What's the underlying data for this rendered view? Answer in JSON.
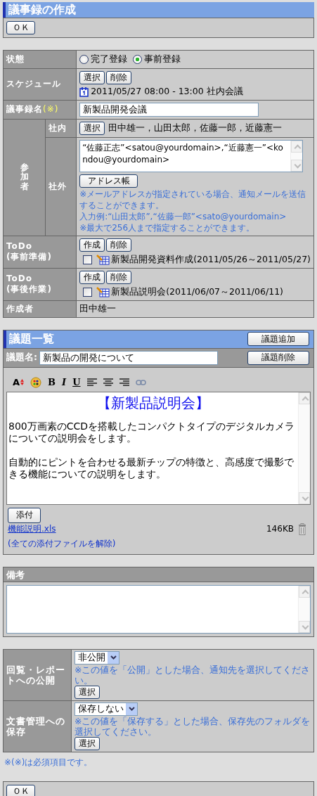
{
  "title": "議事録の作成",
  "top_button": "ＯＫ",
  "form": {
    "status": {
      "label": "状態",
      "options": [
        {
          "label": "完了登録",
          "selected": false
        },
        {
          "label": "事前登録",
          "selected": true
        }
      ]
    },
    "schedule": {
      "label": "スケジュール",
      "buttons": [
        "選択",
        "削除"
      ],
      "entry": "2011/05/27 08:00 - 13:00 社内会議"
    },
    "minutes_name": {
      "label": "議事録名",
      "required_mark": "(※)",
      "value": "新製品開発会議"
    },
    "participants": {
      "label": "参加者",
      "internal": {
        "label": "社内",
        "button": "選択",
        "names": "田中雄一，山田太郎，佐藤一郎，近藤憲一"
      },
      "external": {
        "label": "社外",
        "value": "“佐藤正志”<satou@yourdomain>,“近藤憲一”<kondou@yourdomain>",
        "button": "アドレス帳",
        "notes": [
          "※メールアドレスが指定されている場合、通知メールを送信することができます。",
          "入力例:“山田太郎”,“佐藤一郎”<sato@yourdomain>",
          "※最大で256人まで指定することができます。"
        ]
      }
    },
    "todos": [
      {
        "label": "ToDo",
        "sublabel": "(事前準備)",
        "buttons": [
          "作成",
          "削除"
        ],
        "items": [
          {
            "text": "新製品開発資料作成(2011/05/26～2011/05/27)",
            "checked": false
          }
        ]
      },
      {
        "label": "ToDo",
        "sublabel": "(事後作業)",
        "buttons": [
          "作成",
          "削除"
        ],
        "items": [
          {
            "text": "新製品説明会(2011/06/07～2011/06/11)",
            "checked": false
          }
        ]
      }
    ],
    "author": {
      "label": "作成者",
      "value": "田中雄一"
    }
  },
  "agenda": {
    "title": "議題一覧",
    "add_button": "議題追加",
    "name_label": "議題名:",
    "name_value": "新製品の開発について",
    "delete_button": "議題削除",
    "toolbar": [
      {
        "kind": "font-size",
        "glyph": "A"
      },
      {
        "kind": "color"
      },
      {
        "kind": "bold",
        "glyph": "B"
      },
      {
        "kind": "italic",
        "glyph": "I"
      },
      {
        "kind": "underline",
        "glyph": "U"
      },
      {
        "kind": "align-left"
      },
      {
        "kind": "align-center"
      },
      {
        "kind": "align-right"
      },
      {
        "kind": "link"
      }
    ],
    "editor": {
      "heading": "【新製品説明会】",
      "paragraphs": [
        "800万画素のCCDを搭載したコンパクトタイプのデジタルカメラについての説明会をします。",
        "自動的にピントを合わせる最新チップの特徴と、高感度で撮影できる機能についての説明をします。"
      ]
    },
    "attach_button": "添付",
    "attachments": [
      {
        "name": "機能説明.xls",
        "size": "146KB"
      }
    ],
    "remove_all": "(全ての添付ファイルを解除)"
  },
  "remarks": {
    "label": "備考"
  },
  "publish": [
    {
      "label": "回覧・レポートへの公開",
      "select": "非公開",
      "note": "※この値を「公開」とした場合、通知先を選択してください。",
      "button": "選択"
    },
    {
      "label": "文書管理への保存",
      "select": "保存しない",
      "note": "※この値を「保存する」とした場合、保存先のフォルダを選択してください。",
      "button": "選択"
    }
  ],
  "footnote": "※(※)は必須項目です。",
  "bottom_button": "ＯＫ"
}
